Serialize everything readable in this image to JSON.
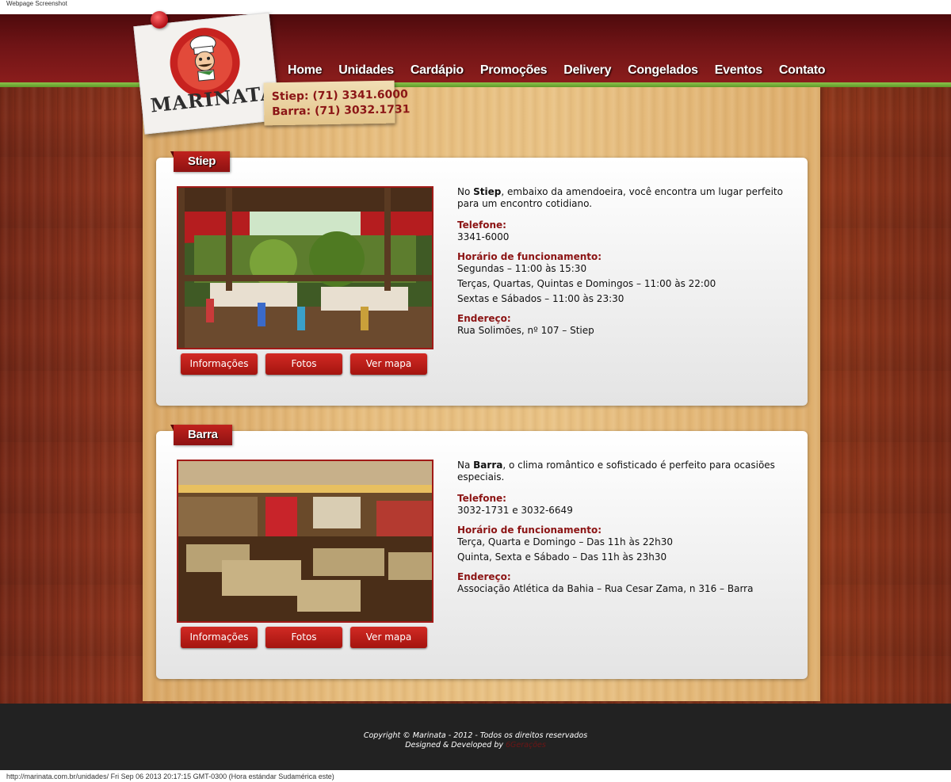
{
  "page": {
    "top_caption": "Webpage Screenshot",
    "status_bar": "http://marinata.com.br/unidades/ Fri Sep 06 2013 20:17:15 GMT-0300 (Hora estándar Sudamérica este)"
  },
  "brand": {
    "logo_text": "MARINATA"
  },
  "phones": {
    "stiep": "Stiep:  (71) 3341.6000",
    "barra": "Barra: (71) 3032.1731"
  },
  "nav": {
    "items": [
      "Home",
      "Unidades",
      "Cardápio",
      "Promoções",
      "Delivery",
      "Congelados",
      "Eventos",
      "Contato"
    ]
  },
  "units": [
    {
      "tab": "Stiep",
      "intro_prefix": "No ",
      "intro_bold": "Stiep",
      "intro_suffix": ", embaixo da amendoeira, você encontra um lugar perfeito para um encontro cotidiano.",
      "phone_label": "Telefone:",
      "phone_value": "3341-6000",
      "hours_label": "Horário de funcionamento:",
      "hours": [
        "Segundas – 11:00 às 15:30",
        "Terças, Quartas, Quintas e Domingos – 11:00 às 22:00",
        "Sextas e Sábados – 11:00 às 23:30"
      ],
      "address_label": "Endereço:",
      "address_value": "Rua Solimões, nº 107 – Stiep",
      "buttons": [
        "Informações",
        "Fotos",
        "Ver mapa"
      ]
    },
    {
      "tab": "Barra",
      "intro_prefix": "Na ",
      "intro_bold": "Barra",
      "intro_suffix": ", o clima romântico e sofisticado é perfeito para ocasiões especiais.",
      "phone_label": "Telefone:",
      "phone_value": "3032-1731 e 3032-6649",
      "hours_label": "Horário de funcionamento:",
      "hours": [
        "Terça, Quarta e Domingo – Das 11h às 22h30",
        "Quinta, Sexta e Sábado – Das 11h às 23h30"
      ],
      "address_label": "Endereço:",
      "address_value": "Associação Atlética da Bahia – Rua Cesar Zama, n 316 – Barra",
      "buttons": [
        "Informações",
        "Fotos",
        "Ver mapa"
      ]
    }
  ],
  "footer": {
    "copyright": "Copyright © Marinata - 2012 - Todos os direitos reservados",
    "designed_prefix": "Designed & Developed by ",
    "designed_brand": "6Gerações"
  },
  "colors": {
    "header_dark": "#4e0a0c",
    "accent_red": "#8c1414",
    "green_stripe": "#8bc34a",
    "panel_wood": "#e6bc7c"
  }
}
